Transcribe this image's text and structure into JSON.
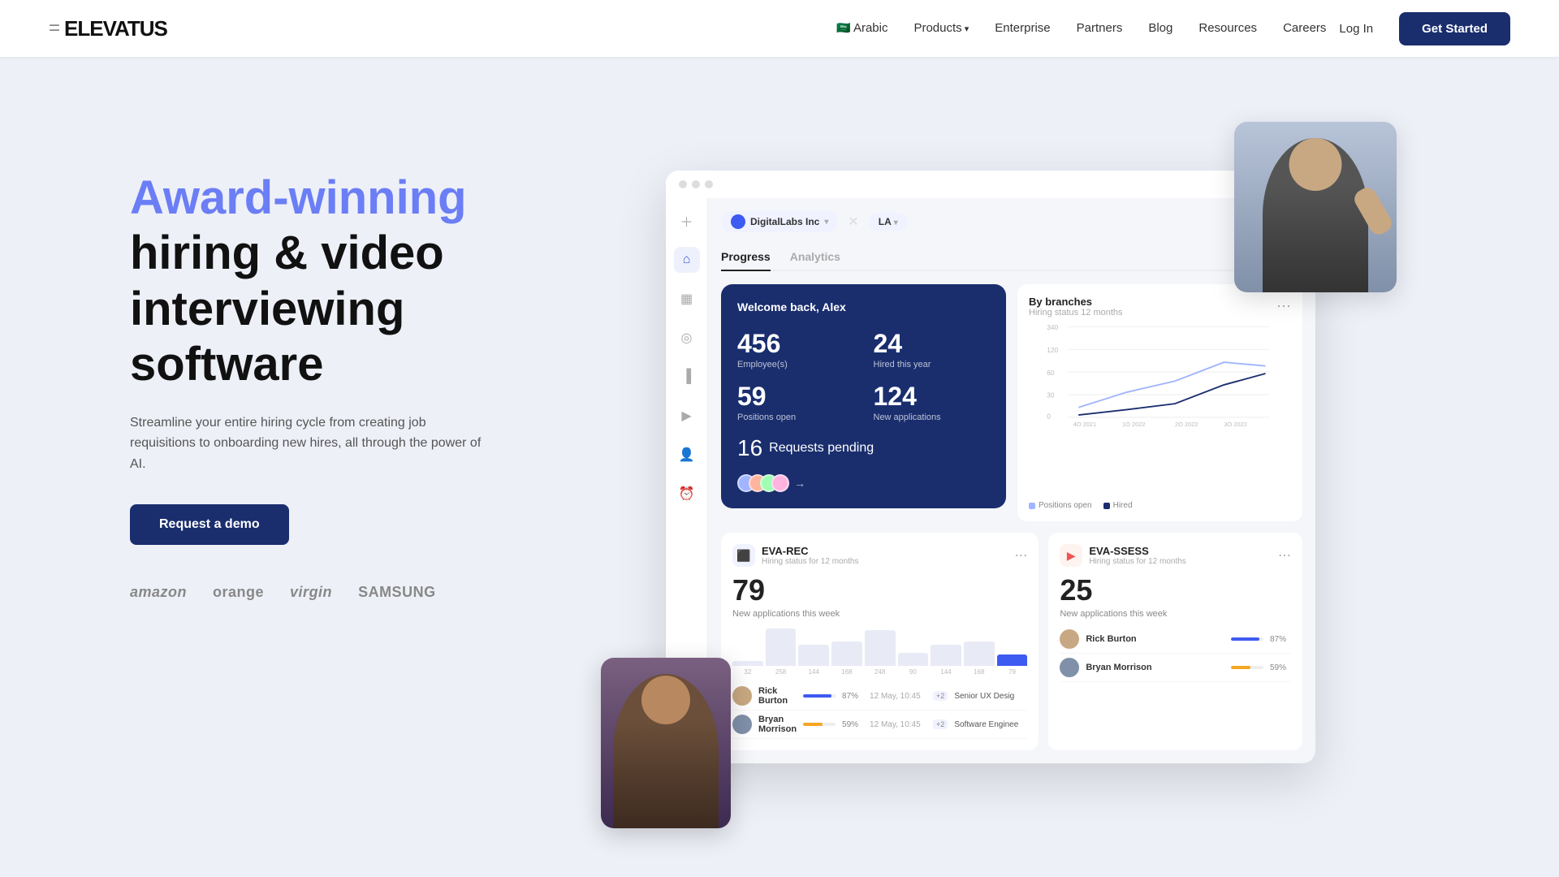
{
  "nav": {
    "logo": "ELEVATUS",
    "links": [
      "Arabic",
      "Products",
      "Enterprise",
      "Partners",
      "Blog",
      "Resources",
      "Careers"
    ],
    "login_label": "Log In",
    "cta_label": "Get Started"
  },
  "hero": {
    "title_part1": "Award-winning",
    "title_part2": "hiring & video interviewing software",
    "subtitle": "Streamline your entire hiring cycle from creating job requisitions to onboarding new hires, all through the power of AI.",
    "demo_label": "Request a demo",
    "clients": [
      "amazon",
      "orange",
      "virgin",
      "SAMSUNG"
    ]
  },
  "dashboard": {
    "company": "DigitalLabs Inc",
    "lang": "LA",
    "tabs": [
      "Progress",
      "Analytics"
    ],
    "active_tab": "Progress",
    "welcome": "Welcome back, Alex",
    "stats": {
      "employees_val": "456",
      "employees_label": "Employee(s)",
      "hired_val": "24",
      "hired_label": "Hired this year",
      "positions_val": "59",
      "positions_label": "Positions open",
      "applications_val": "124",
      "applications_label": "New applications",
      "pending_val": "16",
      "pending_label": "Requests pending"
    },
    "chart": {
      "title": "By branches",
      "subtitle": "Hiring status  12 months",
      "y_labels": [
        "340",
        "120",
        "60",
        "30",
        "0"
      ],
      "x_labels": [
        "4Q 2021",
        "1Q 2022",
        "2Q 2022",
        "3Q 2022"
      ],
      "legend": [
        "Positions open",
        "Hired"
      ]
    },
    "products": [
      {
        "name": "EVA-REC",
        "period": "Hiring status for 12 months",
        "big_num": "79",
        "big_label": "New applications this week",
        "bars": [
          32,
          258,
          144,
          168,
          248,
          90,
          144,
          168,
          79
        ],
        "bar_labels": [
          "32",
          "258",
          "144",
          "168",
          "248",
          "90",
          "144",
          "168",
          "79"
        ]
      },
      {
        "name": "EVA-SSESS",
        "period": "Hiring status for 12 months",
        "big_num": "25",
        "big_label": "New applications this week"
      }
    ],
    "candidates": [
      {
        "name": "Rick Burton",
        "pct": 87,
        "date": "12 May, 10:45",
        "plus": "+2",
        "role": "Senior UX Desig"
      },
      {
        "name": "Bryan Morrison",
        "pct": 59,
        "date": "12 May, 10:45",
        "plus": "+2",
        "role": "Software Enginee"
      }
    ]
  }
}
